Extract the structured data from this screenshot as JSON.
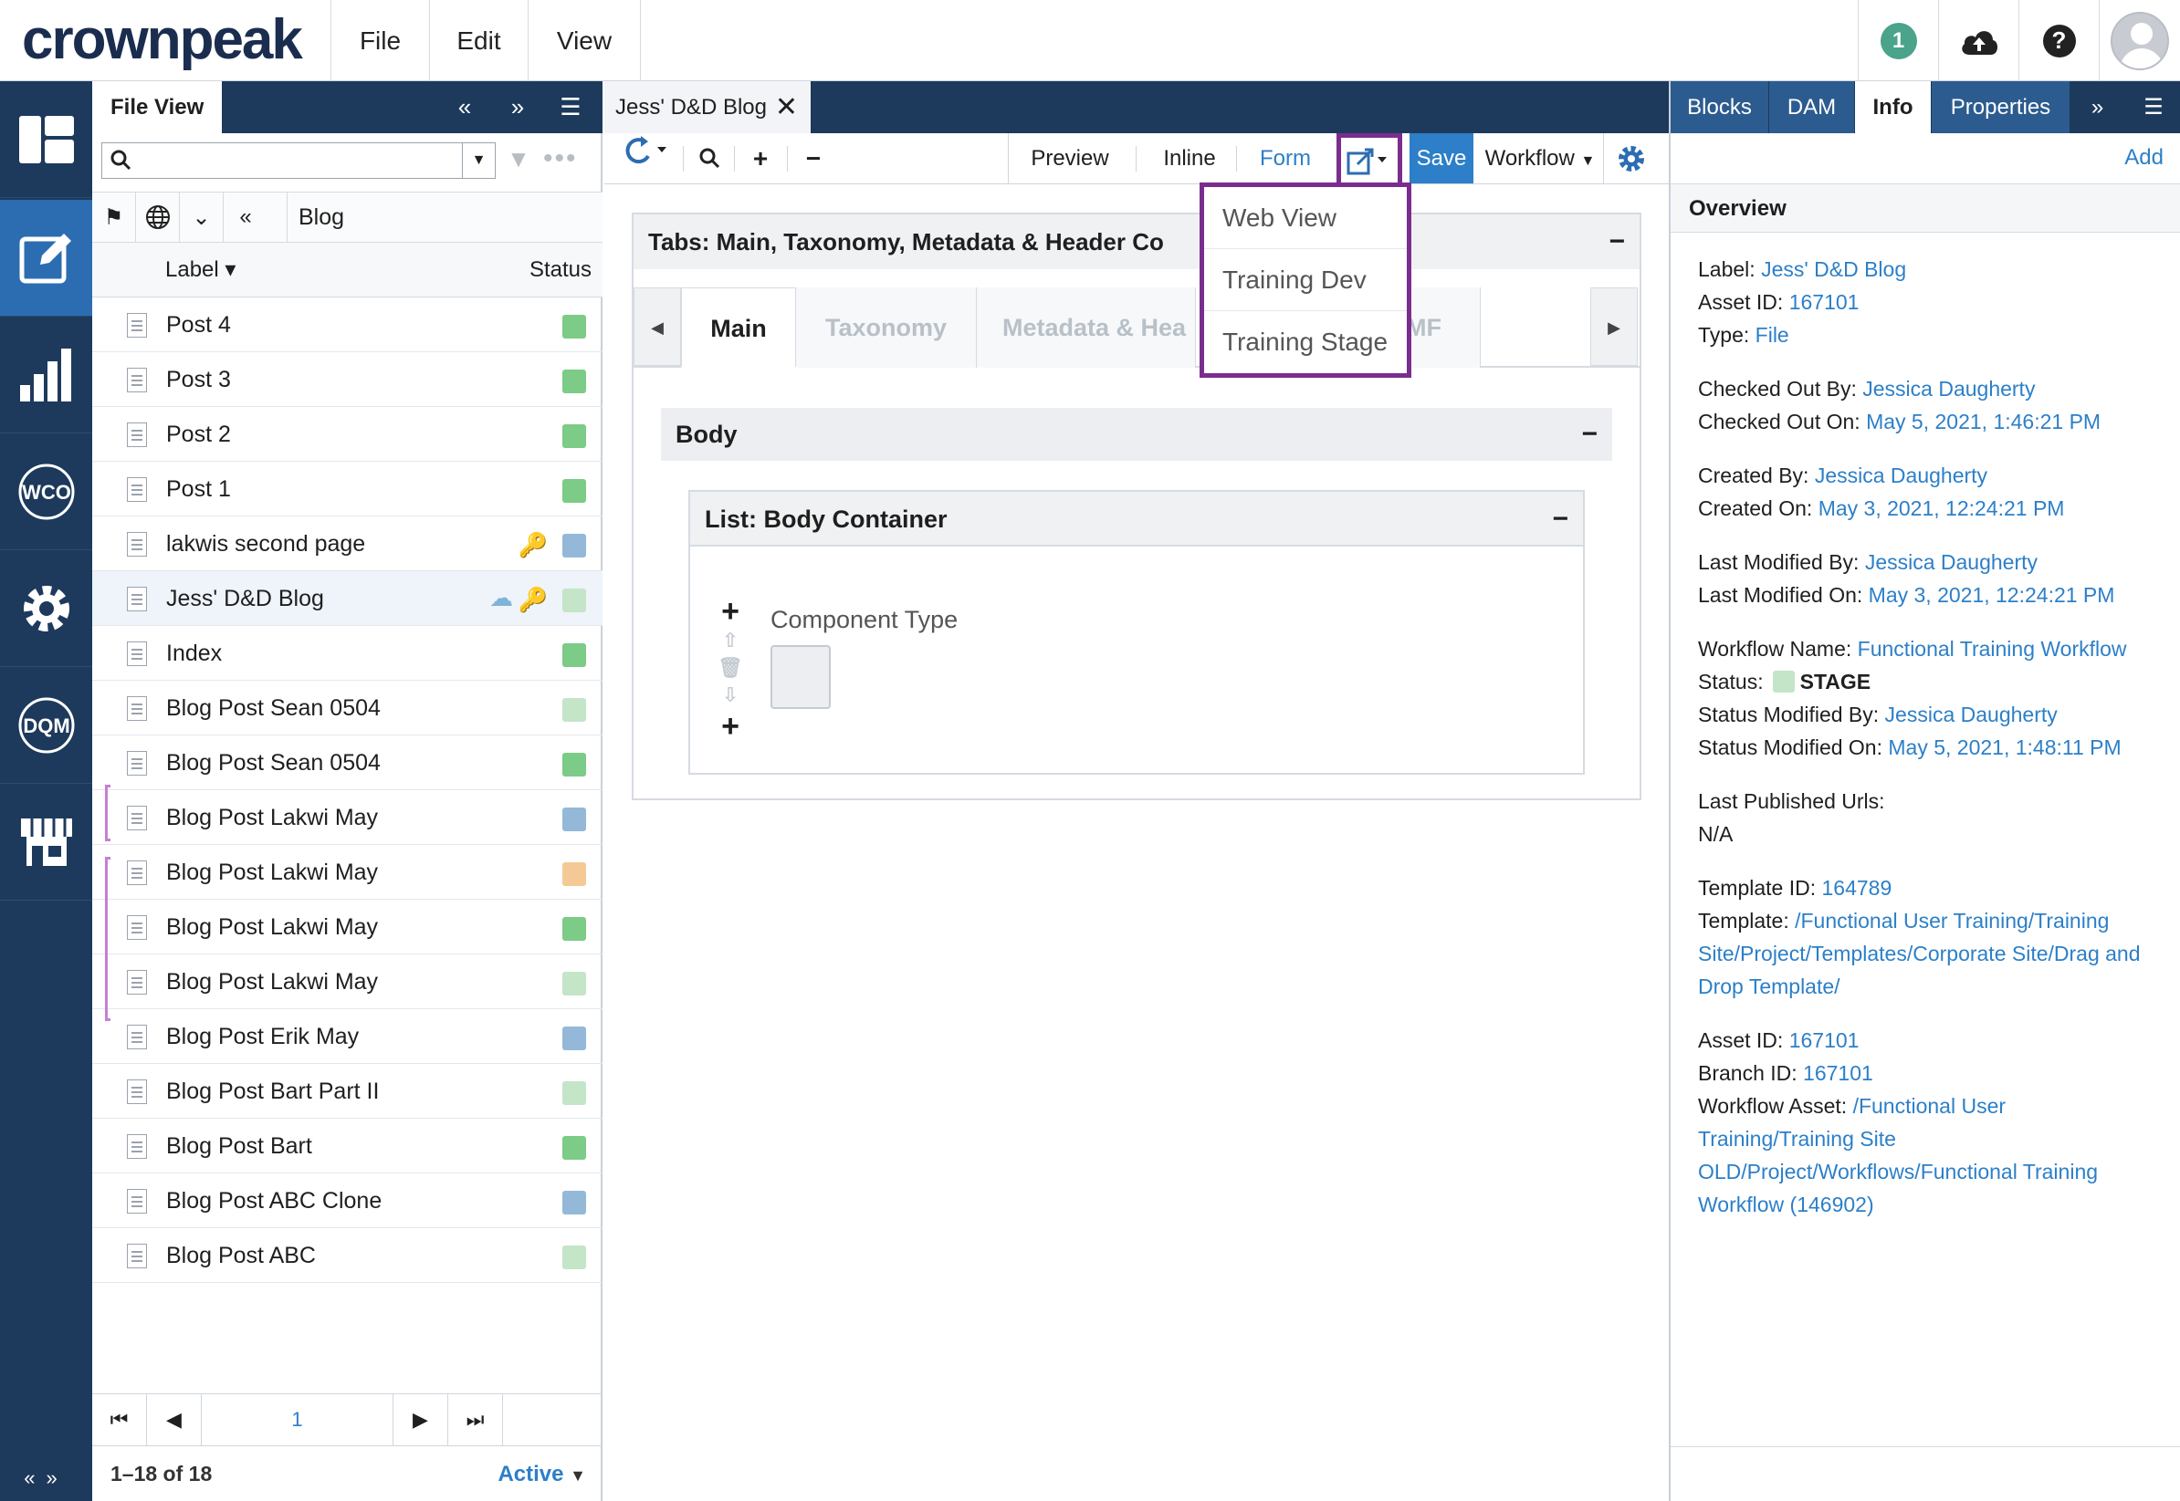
{
  "app": {
    "logo": "crownpeak",
    "menu": [
      "File",
      "Edit",
      "View"
    ],
    "notification_count": "1"
  },
  "file_view": {
    "title": "File View",
    "search_placeholder": "",
    "breadcrumb": "Blog",
    "col_label": "Label",
    "col_status": "Status",
    "rows": [
      {
        "label": "Post 4",
        "status": "#7ccb86"
      },
      {
        "label": "Post 3",
        "status": "#7ccb86"
      },
      {
        "label": "Post 2",
        "status": "#7ccb86"
      },
      {
        "label": "Post 1",
        "status": "#7ccb86"
      },
      {
        "label": "lakwis second page",
        "status": "#94b9d8",
        "key": true
      },
      {
        "label": "Jess' D&D Blog",
        "status": "#c4e5c7",
        "key": true,
        "cloud": true,
        "selected": true
      },
      {
        "label": "Index",
        "status": "#7ccb86"
      },
      {
        "label": "Blog Post Sean 0504",
        "status": "#c4e5c7"
      },
      {
        "label": "Blog Post Sean 0504",
        "status": "#7ccb86"
      },
      {
        "label": "Blog Post Lakwi May",
        "status": "#94b9d8"
      },
      {
        "label": "Blog Post Lakwi May",
        "status": "#f5c996"
      },
      {
        "label": "Blog Post Lakwi May",
        "status": "#7ccb86"
      },
      {
        "label": "Blog Post Lakwi May",
        "status": "#c4e5c7"
      },
      {
        "label": "Blog Post Erik May",
        "status": "#94b9d8"
      },
      {
        "label": "Blog Post Bart Part II",
        "status": "#c4e5c7"
      },
      {
        "label": "Blog Post Bart",
        "status": "#7ccb86"
      },
      {
        "label": "Blog Post ABC Clone",
        "status": "#94b9d8"
      },
      {
        "label": "Blog Post ABC",
        "status": "#c4e5c7"
      }
    ],
    "page": "1",
    "count": "1–18 of 18",
    "filter": "Active"
  },
  "editor": {
    "tab_title": "Jess' D&D Blog",
    "toolbar": {
      "preview": "Preview",
      "inline": "Inline",
      "form": "Form",
      "save": "Save",
      "workflow": "Workflow"
    },
    "tabs_section": "Tabs: Main, Taxonomy, Metadata & Header Co",
    "form_tabs": [
      "Main",
      "Taxonomy",
      "Metadata & Hea",
      "MF"
    ],
    "body_section": "Body",
    "list_section": "List: Body Container",
    "component_label": "Component Type",
    "dropdown": [
      "Web View",
      "Training Dev",
      "Training Stage"
    ]
  },
  "right_panel": {
    "tabs": [
      "Blocks",
      "DAM",
      "Info",
      "Properties"
    ],
    "add": "Add",
    "overview": "Overview",
    "info": {
      "label_k": "Label:",
      "label_v": "Jess' D&D Blog",
      "asset_k": "Asset ID:",
      "asset_v": "167101",
      "type_k": "Type:",
      "type_v": "File",
      "coby_k": "Checked Out By:",
      "coby_v": "Jessica Daugherty",
      "coon_k": "Checked Out On:",
      "coon_v": "May 5, 2021, 1:46:21 PM",
      "crby_k": "Created By:",
      "crby_v": "Jessica Daugherty",
      "cron_k": "Created On:",
      "cron_v": "May 3, 2021, 12:24:21 PM",
      "lmby_k": "Last Modified By:",
      "lmby_v": "Jessica Daugherty",
      "lmon_k": "Last Modified On:",
      "lmon_v": "May 3, 2021, 12:24:21 PM",
      "wfn_k": "Workflow Name:",
      "wfn_v": "Functional Training Workflow",
      "status_k": "Status:",
      "status_v": "STAGE",
      "smby_k": "Status Modified By:",
      "smby_v": "Jessica Daugherty",
      "smon_k": "Status Modified On:",
      "smon_v": "May 5, 2021, 1:48:11 PM",
      "lpu_k": "Last Published Urls:",
      "lpu_v": "N/A",
      "tid_k": "Template ID:",
      "tid_v": "164789",
      "tpl_k": "Template:",
      "tpl_v": "/Functional User Training/Training Site/Project/Templates/Corporate Site/Drag and Drop Template/",
      "aid2_k": "Asset ID:",
      "aid2_v": "167101",
      "bid_k": "Branch ID:",
      "bid_v": "167101",
      "wfa_k": "Workflow Asset:",
      "wfa_v": "/Functional User Training/Training Site OLD/Project/Workflows/Functional Training Workflow (146902)"
    }
  }
}
